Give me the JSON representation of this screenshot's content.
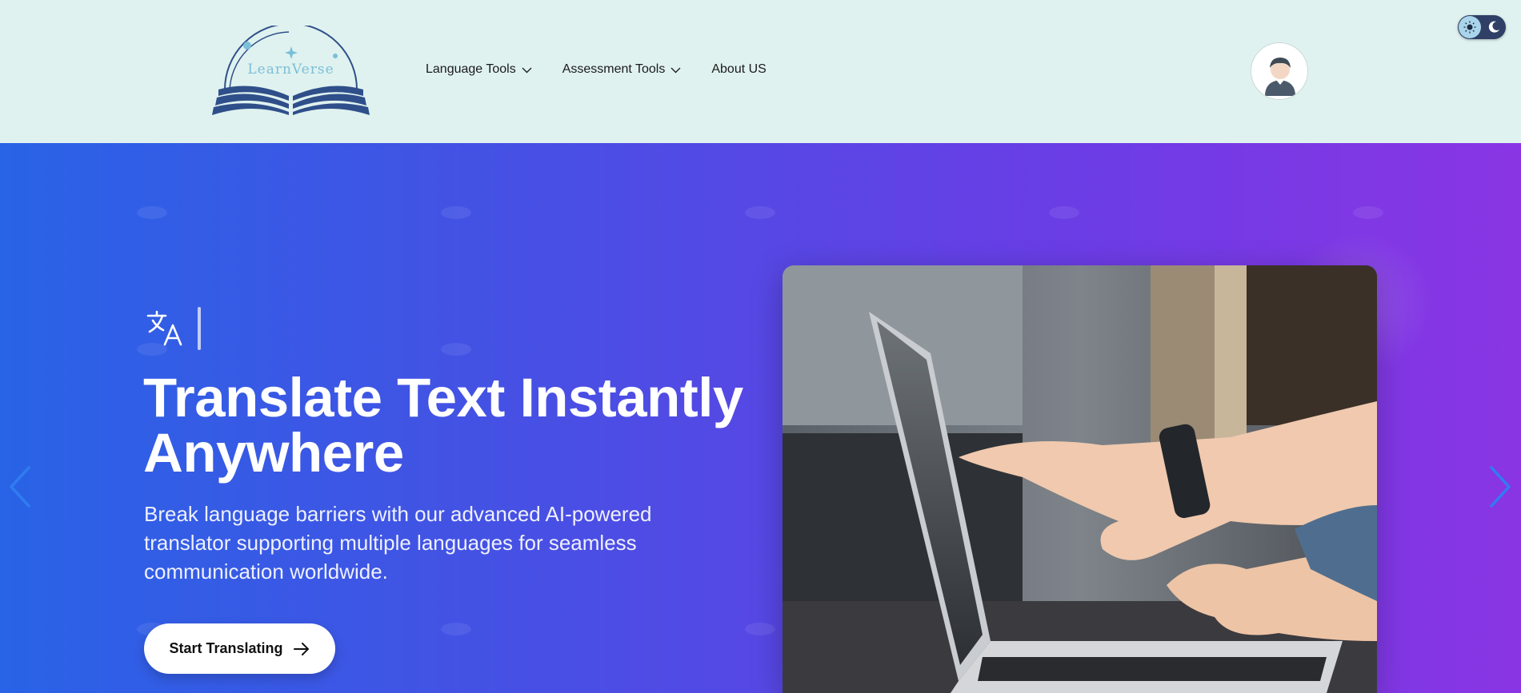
{
  "brand": {
    "logo_text": "LearnVerse"
  },
  "nav": {
    "items": [
      {
        "label": "Language Tools",
        "has_dropdown": true
      },
      {
        "label": "Assessment Tools",
        "has_dropdown": true
      },
      {
        "label": "About US",
        "has_dropdown": false
      }
    ]
  },
  "header": {
    "avatar_icon": "user-avatar-icon",
    "theme_toggle_icons": [
      "sun-icon",
      "moon-icon"
    ]
  },
  "hero": {
    "icon": "translate-icon",
    "title": "Translate Text Instantly Anywhere",
    "description": "Break language barriers with our advanced AI-powered translator supporting multiple languages for seamless communication worldwide.",
    "cta_label": "Start Translating",
    "cta_icon": "arrow-right-icon",
    "image_icon": "laptop-hands-photo"
  },
  "colors": {
    "header_bg": "#dff2ef",
    "hero_gradient_start": "#2963e6",
    "hero_gradient_end": "#8a35e4",
    "logo_blue": "#2f4f8a",
    "carousel_arrow": "#2f7df0"
  }
}
